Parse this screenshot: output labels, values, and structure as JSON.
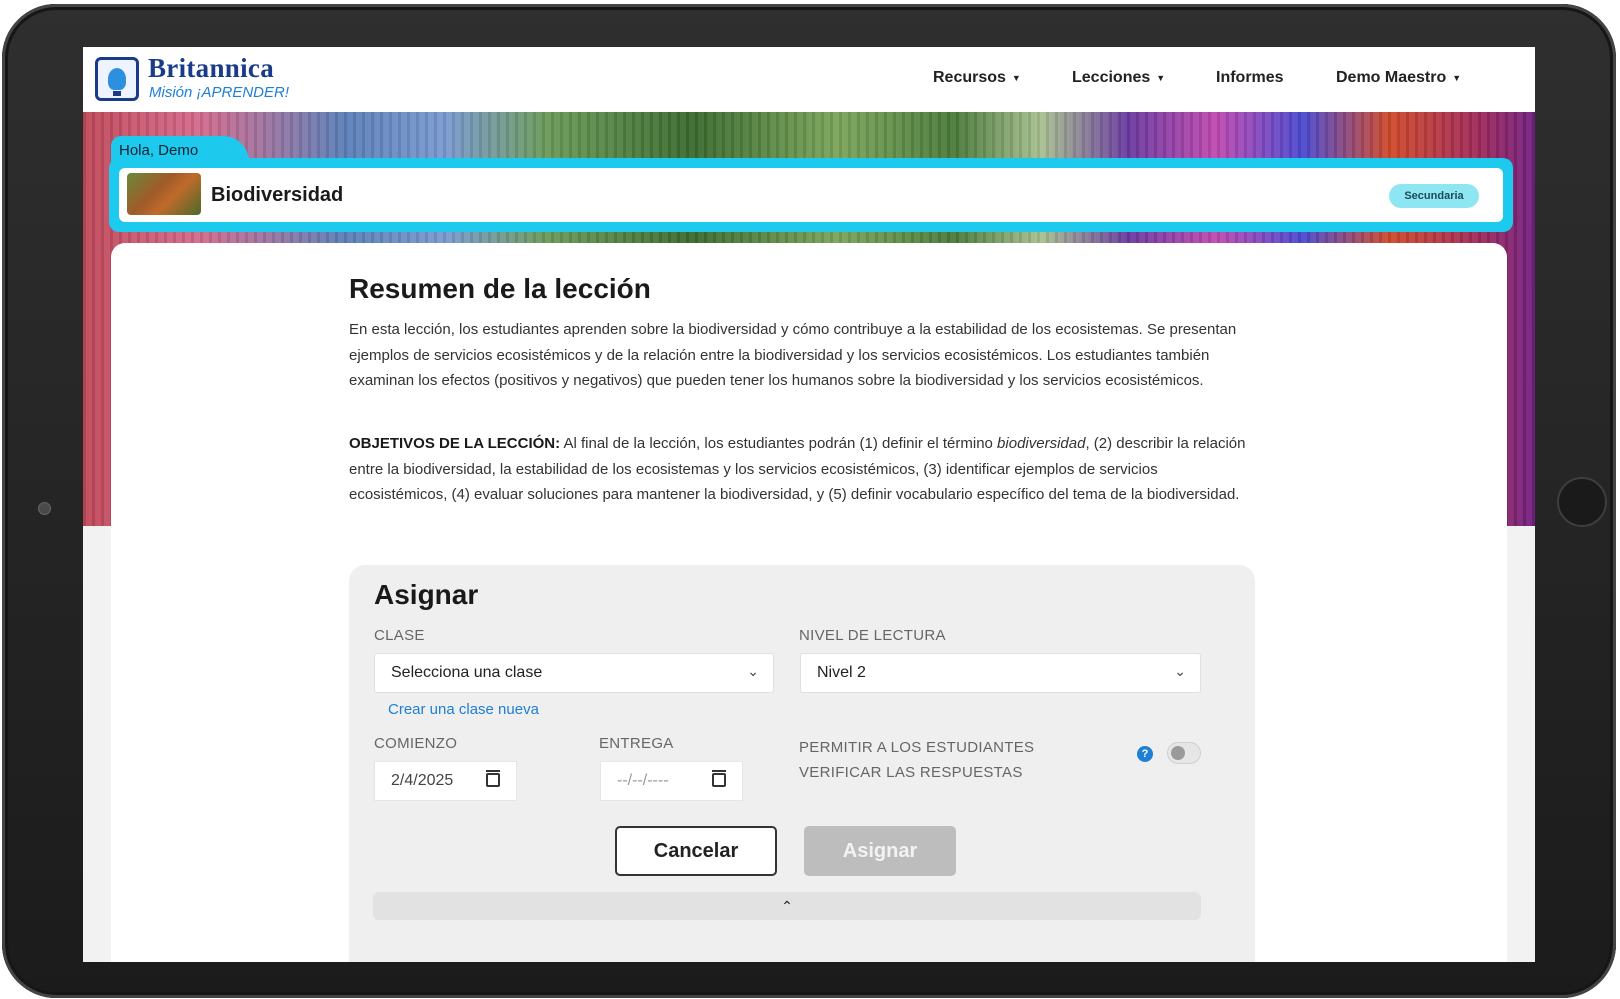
{
  "nav": {
    "logo_title": "Britannica",
    "logo_subtitle": "Misión ¡APRENDER!",
    "recursos": "Recursos",
    "lecciones": "Lecciones",
    "informes": "Informes",
    "user": "Demo Maestro"
  },
  "banner": {
    "greeting": "Hola, Demo",
    "lesson_title": "Biodiversidad",
    "level_badge": "Secundaria"
  },
  "summary": {
    "title": "Resumen de la lección",
    "text": "En esta lección, los estudiantes aprenden sobre la biodiversidad y cómo contribuye a la estabilidad de los ecosistemas. Se presentan ejemplos de servicios ecosistémicos y de la relación entre la biodiversidad y los servicios ecosistémicos. Los estudiantes también examinan los efectos (positivos y negativos) que pueden tener los humanos sobre la biodiversidad y los servicios ecosistémicos.",
    "objectives_label": "OBJETIVOS DE LA LECCIÓN:",
    "objectives_part1": " Al final de la lección, los estudiantes podrán (1) definir el término ",
    "objectives_term": "biodiversidad",
    "objectives_part2": ", (2) describir la relación entre la biodiversidad, la estabilidad de los ecosistemas y los servicios ecosistémicos, (3) identificar ejemplos de servicios ecosistémicos, (4) evaluar soluciones para mantener la biodiversidad, y (5) definir vocabulario específico del tema de la biodiversidad."
  },
  "assign": {
    "title": "Asignar",
    "class_label": "CLASE",
    "class_value": "Selecciona una clase",
    "create_class_link": "Crear una clase nueva",
    "reading_label": "NIVEL DE LECTURA",
    "reading_value": "Nivel 2",
    "start_label": "COMIENZO",
    "start_value": "2/4/2025",
    "due_label": "ENTREGA",
    "due_value": "--/--/----",
    "allow_label_line1": "PERMITIR A LOS ESTUDIANTES",
    "allow_label_line2": "VERIFICAR LAS RESPUESTAS",
    "allow_enabled": false,
    "cancel_button": "Cancelar",
    "assign_button": "Asignar"
  },
  "icons": {
    "help": "?",
    "collapse": "⌃"
  }
}
